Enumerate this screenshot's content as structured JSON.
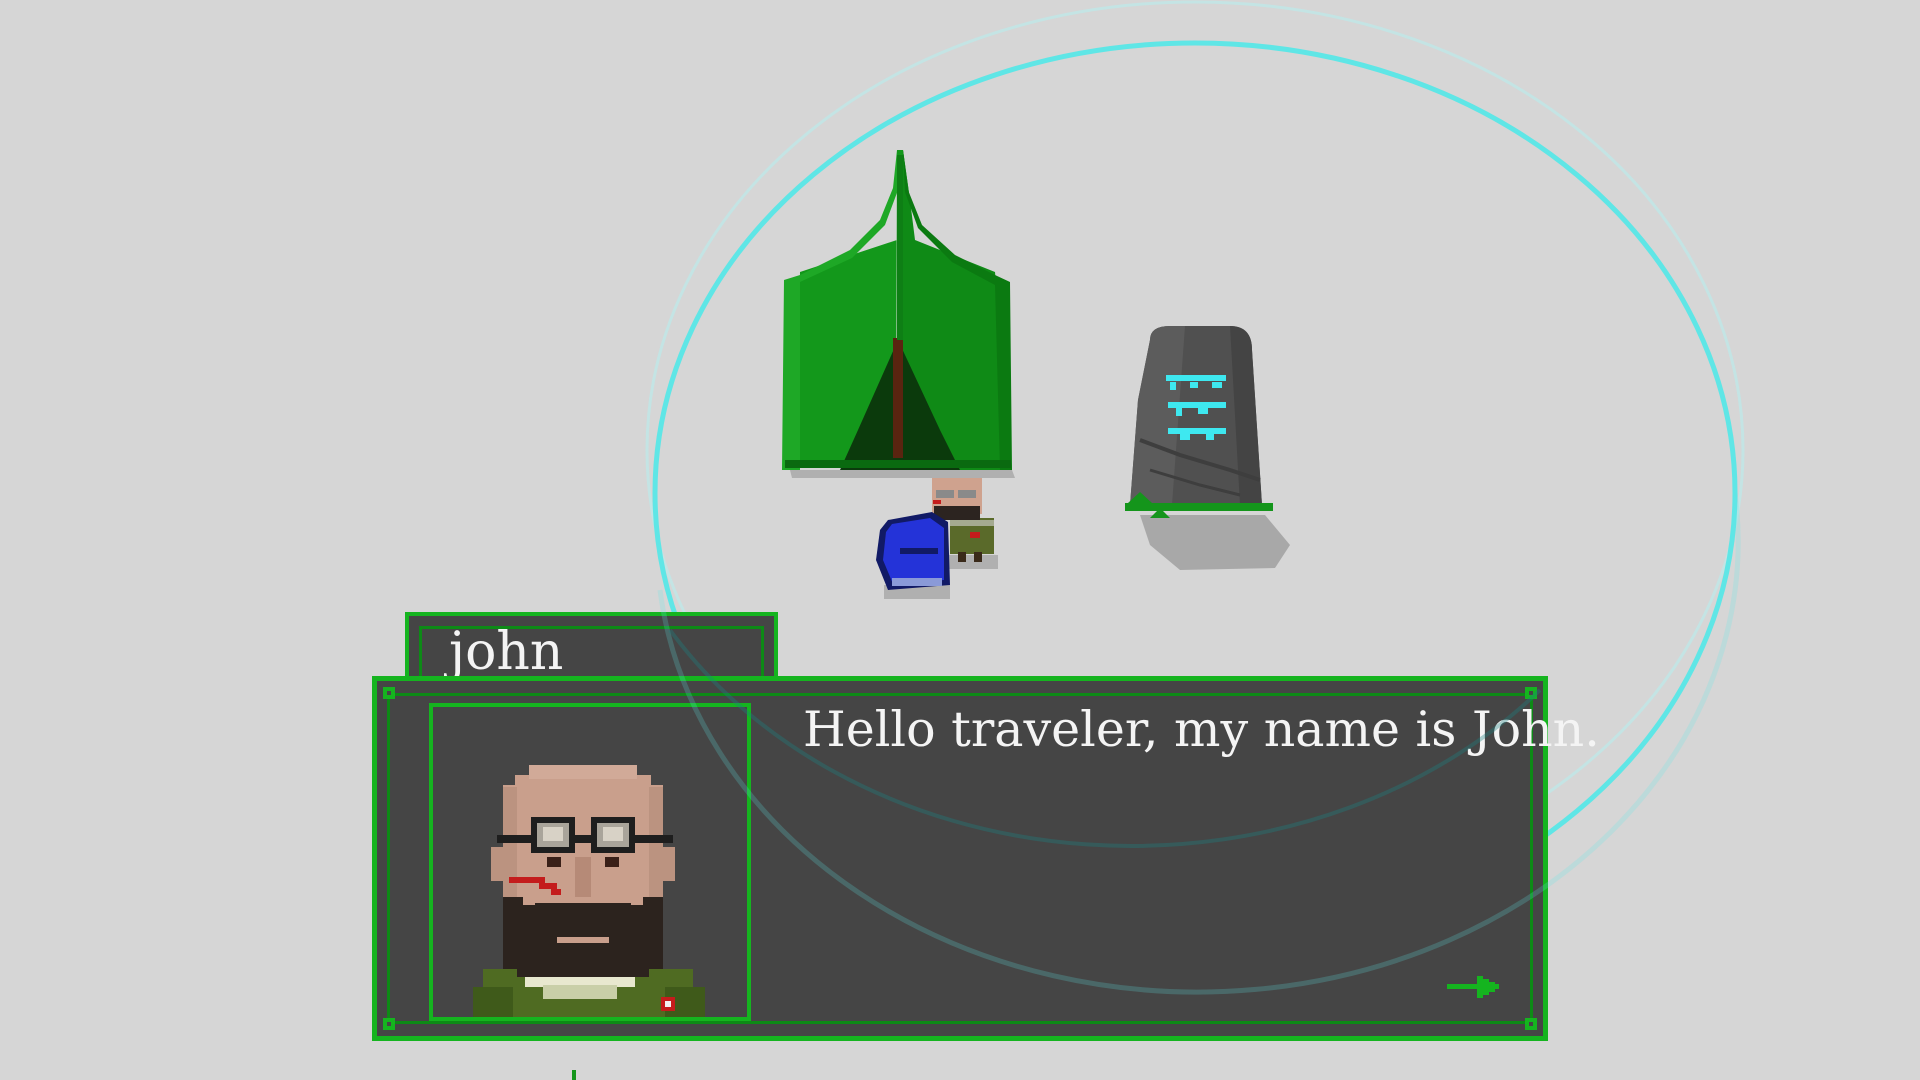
{
  "dialogue": {
    "speaker_name": "john",
    "message": "Hello traveler, my name is John.",
    "continue_icon": "arrow-right-icon"
  },
  "colors": {
    "background": "#d6d6d6",
    "panel": "#454545",
    "border_accent": "#15b41f",
    "text": "#f4f4f4",
    "aura_ring": "#5fe6e6",
    "rune_glow": "#3ee8f0",
    "player_blue": "#2433d8",
    "tent_green": "#129418"
  },
  "scene": {
    "objects": [
      "tent",
      "rune-stone",
      "npc-john",
      "player-character",
      "aura-ring"
    ]
  }
}
